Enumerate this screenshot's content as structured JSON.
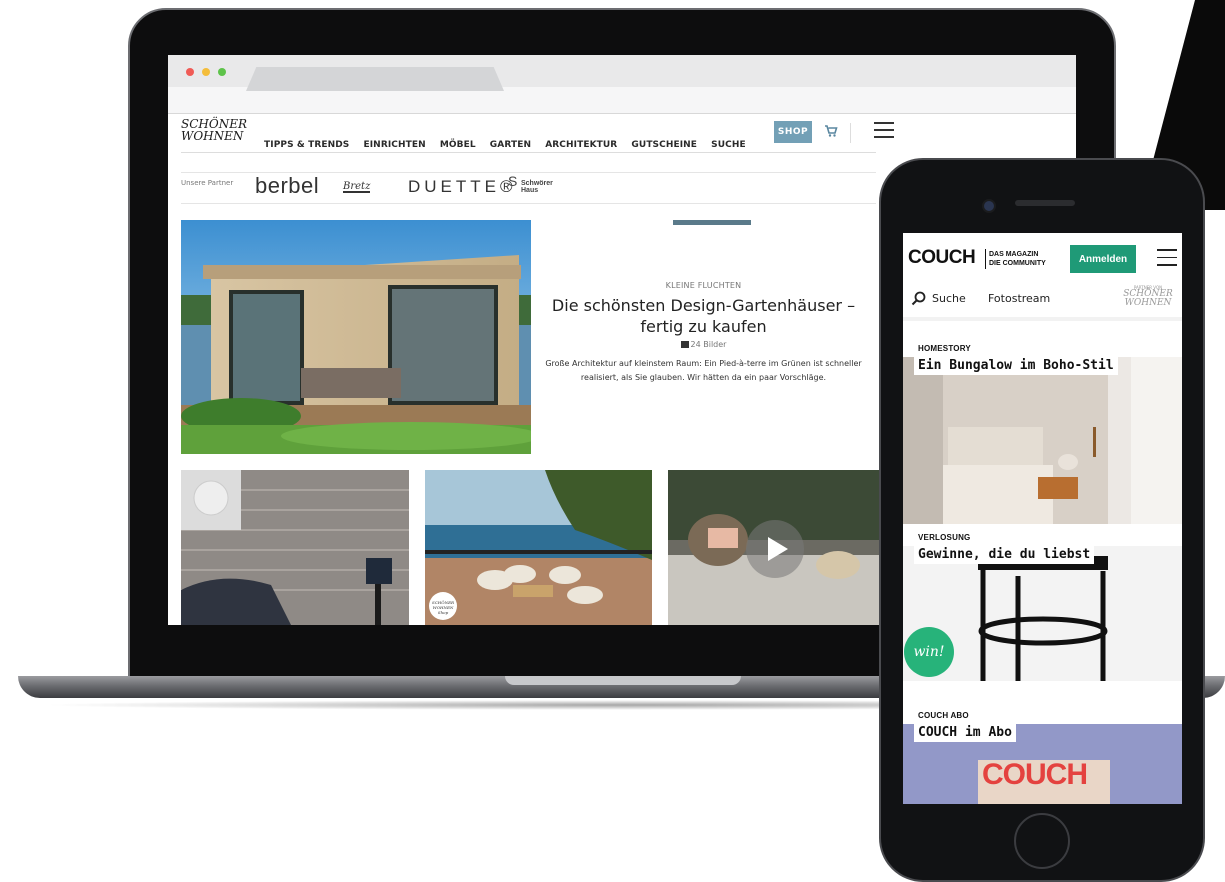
{
  "desktop": {
    "logo": {
      "line1": "SCHÖNER",
      "line2": "WOHNEN"
    },
    "nav": [
      "TIPPS & TRENDS",
      "EINRICHTEN",
      "MÖBEL",
      "GARTEN",
      "ARCHITEKTUR",
      "GUTSCHEINE",
      "SUCHE"
    ],
    "shop_label": "SHOP",
    "partners_label": "Unsere Partner",
    "partners": [
      "berbel",
      "Bretz",
      "DUETTE®",
      "Schwörer Haus"
    ],
    "hero": {
      "kicker": "KLEINE FLUCHTEN",
      "title": "Die schönsten Design-Gartenhäuser – fertig zu kaufen",
      "gallery_count": "24 Bilder",
      "teaser": "Große Architektur auf kleinstem Raum: Ein Pied-à-terre im Grünen ist schneller realisiert, als Sie glauben. Wir hätten da ein paar Vorschläge."
    },
    "badge_text": "SCHÖNER WOHNEN Shop"
  },
  "mobile": {
    "brand": "COUCH",
    "tagline_1": "DAS MAGAZIN",
    "tagline_2": "DIE COMMUNITY",
    "login_label": "Anmelden",
    "search_label": "Suche",
    "fotostream_label": "Fotostream",
    "partner_label": "PARTNER VON",
    "partner_logo_1": "SCHÖNER",
    "partner_logo_2": "WOHNEN",
    "cards": [
      {
        "kicker": "HOMESTORY",
        "title": "Ein Bungalow im Boho-Stil"
      },
      {
        "kicker": "VERLOSUNG",
        "title": "Gewinne, die du liebst",
        "badge": "win!"
      },
      {
        "kicker": "COUCH ABO",
        "title": "COUCH im Abo",
        "cover_text": "COUCH"
      }
    ]
  },
  "colors": {
    "shop_button": "#73a0b6",
    "login_button": "#1f9a77",
    "win_badge": "#27b37a",
    "abo_bg": "#9298c8",
    "cover_red": "#e4423f"
  }
}
